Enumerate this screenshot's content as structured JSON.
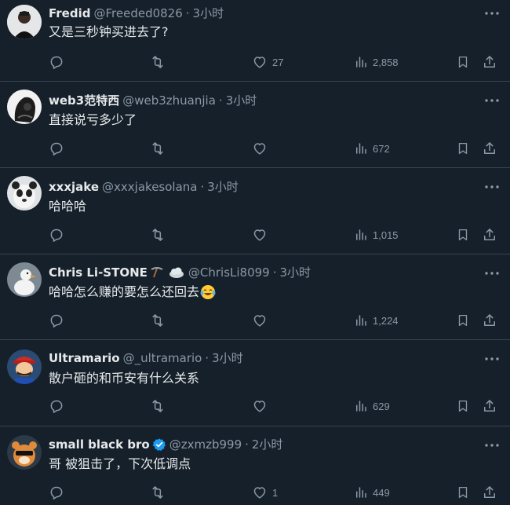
{
  "colors": {
    "background": "#15202b",
    "divider": "#38444d",
    "text_primary": "#e7e9ea",
    "text_secondary": "#8b98a5",
    "verified": "#1d9bf0"
  },
  "replies": [
    {
      "name": "Fredid",
      "handle": "@Freeded0826",
      "separator": "·",
      "time": "3小时",
      "text": "又是三秒钟买进去了?",
      "likes": "27",
      "views": "2,858"
    },
    {
      "name": "web3范特西",
      "handle": "@web3zhuanjia",
      "separator": "·",
      "time": "3小时",
      "text": "直接说亏多少了",
      "likes": "",
      "views": "672"
    },
    {
      "name": "xxxjake",
      "handle": "@xxxjakesolana",
      "separator": "·",
      "time": "3小时",
      "text": "哈哈哈",
      "likes": "",
      "views": "1,015"
    },
    {
      "name": "Chris Li-STONE",
      "handle": "@ChrisLi8099",
      "separator": "·",
      "time": "3小时",
      "text": "哈哈怎么赚的要怎么还回去",
      "likes": "",
      "views": "1,224",
      "name_icons": [
        "pickaxe-icon",
        "cloud-icon"
      ],
      "text_emoji": "laughing-tears-emoji"
    },
    {
      "name": "Ultramario",
      "handle": "@_ultramario",
      "separator": "·",
      "time": "3小时",
      "text": "散户砸的和币安有什么关系",
      "likes": "",
      "views": "629"
    },
    {
      "name": "small black bro",
      "handle": "@zxmzb999",
      "separator": "·",
      "time": "2小时",
      "text": "哥 被狙击了，下次低调点",
      "likes": "1",
      "views": "449",
      "verified": true
    }
  ]
}
